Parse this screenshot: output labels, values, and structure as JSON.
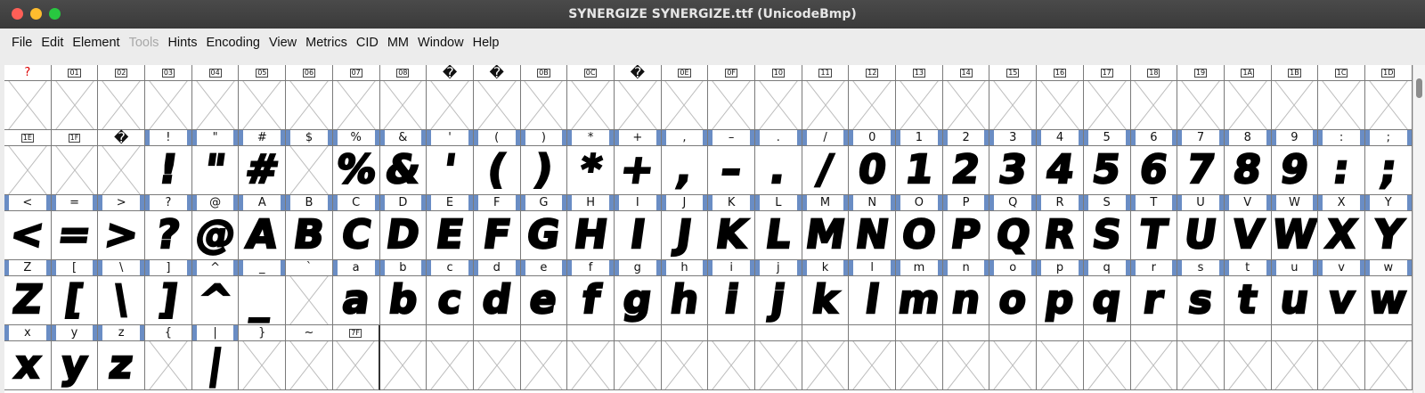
{
  "window": {
    "title": "SYNERGIZE  SYNERGIZE.ttf (UnicodeBmp)"
  },
  "menu": [
    {
      "label": "File",
      "enabled": true
    },
    {
      "label": "Edit",
      "enabled": true
    },
    {
      "label": "Element",
      "enabled": true
    },
    {
      "label": "Tools",
      "enabled": false
    },
    {
      "label": "Hints",
      "enabled": true
    },
    {
      "label": "Encoding",
      "enabled": true
    },
    {
      "label": "View",
      "enabled": true
    },
    {
      "label": "Metrics",
      "enabled": true
    },
    {
      "label": "CID",
      "enabled": true
    },
    {
      "label": "MM",
      "enabled": true
    },
    {
      "label": "Window",
      "enabled": true
    },
    {
      "label": "Help",
      "enabled": true
    }
  ],
  "grid": {
    "columns": 30,
    "rows": [
      [
        {
          "label": "?",
          "glyph": "",
          "style": "red"
        },
        {
          "label": "01",
          "glyph": "",
          "style": "box"
        },
        {
          "label": "02",
          "glyph": "",
          "style": "box"
        },
        {
          "label": "03",
          "glyph": "",
          "style": "box"
        },
        {
          "label": "04",
          "glyph": "",
          "style": "box"
        },
        {
          "label": "05",
          "glyph": "",
          "style": "box"
        },
        {
          "label": "06",
          "glyph": "",
          "style": "box"
        },
        {
          "label": "07",
          "glyph": "",
          "style": "box"
        },
        {
          "label": "08",
          "glyph": "",
          "style": "box"
        },
        {
          "label": "�",
          "glyph": "",
          "style": "q"
        },
        {
          "label": "�",
          "glyph": "",
          "style": "q"
        },
        {
          "label": "0B",
          "glyph": "",
          "style": "box"
        },
        {
          "label": "0C",
          "glyph": "",
          "style": "box"
        },
        {
          "label": "�",
          "glyph": "",
          "style": "q"
        },
        {
          "label": "0E",
          "glyph": "",
          "style": "box"
        },
        {
          "label": "0F",
          "glyph": "",
          "style": "box"
        },
        {
          "label": "10",
          "glyph": "",
          "style": "box"
        },
        {
          "label": "11",
          "glyph": "",
          "style": "box"
        },
        {
          "label": "12",
          "glyph": "",
          "style": "box"
        },
        {
          "label": "13",
          "glyph": "",
          "style": "box"
        },
        {
          "label": "14",
          "glyph": "",
          "style": "box"
        },
        {
          "label": "15",
          "glyph": "",
          "style": "box"
        },
        {
          "label": "16",
          "glyph": "",
          "style": "box"
        },
        {
          "label": "17",
          "glyph": "",
          "style": "box"
        },
        {
          "label": "18",
          "glyph": "",
          "style": "box"
        },
        {
          "label": "19",
          "glyph": "",
          "style": "box"
        },
        {
          "label": "1A",
          "glyph": "",
          "style": "box"
        },
        {
          "label": "1B",
          "glyph": "",
          "style": "box"
        },
        {
          "label": "1C",
          "glyph": "",
          "style": "box"
        },
        {
          "label": "1D",
          "glyph": "",
          "style": "box"
        }
      ],
      [
        {
          "label": "1E",
          "glyph": "",
          "style": "box"
        },
        {
          "label": "1F",
          "glyph": "",
          "style": "box"
        },
        {
          "label": "�",
          "glyph": "",
          "style": "q"
        },
        {
          "label": "!",
          "glyph": "!",
          "style": "hi"
        },
        {
          "label": "\"",
          "glyph": "\"",
          "style": "hi"
        },
        {
          "label": "#",
          "glyph": "#",
          "style": "hi"
        },
        {
          "label": "$",
          "glyph": "",
          "style": "hi"
        },
        {
          "label": "%",
          "glyph": "%",
          "style": "hi"
        },
        {
          "label": "&",
          "glyph": "&",
          "style": "hi"
        },
        {
          "label": "'",
          "glyph": "'",
          "style": "hi"
        },
        {
          "label": "(",
          "glyph": "(",
          "style": "hi"
        },
        {
          "label": ")",
          "glyph": ")",
          "style": "hi"
        },
        {
          "label": "*",
          "glyph": "*",
          "style": "hi"
        },
        {
          "label": "+",
          "glyph": "+",
          "style": "hi"
        },
        {
          "label": ",",
          "glyph": ",",
          "style": "hi"
        },
        {
          "label": "–",
          "glyph": "–",
          "style": "hi"
        },
        {
          "label": ".",
          "glyph": ".",
          "style": "hi"
        },
        {
          "label": "/",
          "glyph": "/",
          "style": "hi"
        },
        {
          "label": "0",
          "glyph": "0",
          "style": "hi"
        },
        {
          "label": "1",
          "glyph": "1",
          "style": "hi"
        },
        {
          "label": "2",
          "glyph": "2",
          "style": "hi"
        },
        {
          "label": "3",
          "glyph": "3",
          "style": "hi"
        },
        {
          "label": "4",
          "glyph": "4",
          "style": "hi"
        },
        {
          "label": "5",
          "glyph": "5",
          "style": "hi"
        },
        {
          "label": "6",
          "glyph": "6",
          "style": "hi"
        },
        {
          "label": "7",
          "glyph": "7",
          "style": "hi"
        },
        {
          "label": "8",
          "glyph": "8",
          "style": "hi"
        },
        {
          "label": "9",
          "glyph": "9",
          "style": "hi"
        },
        {
          "label": ":",
          "glyph": ":",
          "style": "hi"
        },
        {
          "label": ";",
          "glyph": ";",
          "style": "hi"
        }
      ],
      [
        {
          "label": "<",
          "glyph": "<",
          "style": "hi"
        },
        {
          "label": "=",
          "glyph": "=",
          "style": "hi"
        },
        {
          "label": ">",
          "glyph": ">",
          "style": "hi"
        },
        {
          "label": "?",
          "glyph": "?",
          "style": "hi"
        },
        {
          "label": "@",
          "glyph": "@",
          "style": "hi"
        },
        {
          "label": "A",
          "glyph": "A",
          "style": "hi"
        },
        {
          "label": "B",
          "glyph": "B",
          "style": "hi"
        },
        {
          "label": "C",
          "glyph": "C",
          "style": "hi"
        },
        {
          "label": "D",
          "glyph": "D",
          "style": "hi"
        },
        {
          "label": "E",
          "glyph": "E",
          "style": "hi"
        },
        {
          "label": "F",
          "glyph": "F",
          "style": "hi"
        },
        {
          "label": "G",
          "glyph": "G",
          "style": "hi"
        },
        {
          "label": "H",
          "glyph": "H",
          "style": "hi"
        },
        {
          "label": "I",
          "glyph": "I",
          "style": "hi"
        },
        {
          "label": "J",
          "glyph": "J",
          "style": "hi"
        },
        {
          "label": "K",
          "glyph": "K",
          "style": "hi"
        },
        {
          "label": "L",
          "glyph": "L",
          "style": "hi"
        },
        {
          "label": "M",
          "glyph": "M",
          "style": "hi"
        },
        {
          "label": "N",
          "glyph": "N",
          "style": "hi"
        },
        {
          "label": "O",
          "glyph": "O",
          "style": "hi"
        },
        {
          "label": "P",
          "glyph": "P",
          "style": "hi"
        },
        {
          "label": "Q",
          "glyph": "Q",
          "style": "hi"
        },
        {
          "label": "R",
          "glyph": "R",
          "style": "hi"
        },
        {
          "label": "S",
          "glyph": "S",
          "style": "hi"
        },
        {
          "label": "T",
          "glyph": "T",
          "style": "hi"
        },
        {
          "label": "U",
          "glyph": "U",
          "style": "hi"
        },
        {
          "label": "V",
          "glyph": "V",
          "style": "hi"
        },
        {
          "label": "W",
          "glyph": "W",
          "style": "hi"
        },
        {
          "label": "X",
          "glyph": "X",
          "style": "hi"
        },
        {
          "label": "Y",
          "glyph": "Y",
          "style": "hi"
        }
      ],
      [
        {
          "label": "Z",
          "glyph": "Z",
          "style": "hi"
        },
        {
          "label": "[",
          "glyph": "[",
          "style": "hi"
        },
        {
          "label": "\\",
          "glyph": "\\",
          "style": "hi"
        },
        {
          "label": "]",
          "glyph": "]",
          "style": "hi"
        },
        {
          "label": "^",
          "glyph": "^",
          "style": "hi"
        },
        {
          "label": "_",
          "glyph": "_",
          "style": "hi"
        },
        {
          "label": "`",
          "glyph": "",
          "style": "plain"
        },
        {
          "label": "a",
          "glyph": "a",
          "style": "hi"
        },
        {
          "label": "b",
          "glyph": "b",
          "style": "hi"
        },
        {
          "label": "c",
          "glyph": "c",
          "style": "hi"
        },
        {
          "label": "d",
          "glyph": "d",
          "style": "hi"
        },
        {
          "label": "e",
          "glyph": "e",
          "style": "hi"
        },
        {
          "label": "f",
          "glyph": "f",
          "style": "hi"
        },
        {
          "label": "g",
          "glyph": "g",
          "style": "hi"
        },
        {
          "label": "h",
          "glyph": "h",
          "style": "hi"
        },
        {
          "label": "i",
          "glyph": "i",
          "style": "hi"
        },
        {
          "label": "j",
          "glyph": "j",
          "style": "hi"
        },
        {
          "label": "k",
          "glyph": "k",
          "style": "hi"
        },
        {
          "label": "l",
          "glyph": "l",
          "style": "hi"
        },
        {
          "label": "m",
          "glyph": "m",
          "style": "hi"
        },
        {
          "label": "n",
          "glyph": "n",
          "style": "hi"
        },
        {
          "label": "o",
          "glyph": "o",
          "style": "hi"
        },
        {
          "label": "p",
          "glyph": "p",
          "style": "hi"
        },
        {
          "label": "q",
          "glyph": "q",
          "style": "hi"
        },
        {
          "label": "r",
          "glyph": "r",
          "style": "hi"
        },
        {
          "label": "s",
          "glyph": "s",
          "style": "hi"
        },
        {
          "label": "t",
          "glyph": "t",
          "style": "hi"
        },
        {
          "label": "u",
          "glyph": "u",
          "style": "hi"
        },
        {
          "label": "v",
          "glyph": "v",
          "style": "hi"
        },
        {
          "label": "w",
          "glyph": "w",
          "style": "hi"
        }
      ],
      [
        {
          "label": "x",
          "glyph": "x",
          "style": "hi"
        },
        {
          "label": "y",
          "glyph": "y",
          "style": "hi"
        },
        {
          "label": "z",
          "glyph": "z",
          "style": "hi"
        },
        {
          "label": "{",
          "glyph": "",
          "style": "plain"
        },
        {
          "label": "|",
          "glyph": "|",
          "style": "hi"
        },
        {
          "label": "}",
          "glyph": "",
          "style": "plain"
        },
        {
          "label": "~",
          "glyph": "",
          "style": "plain"
        },
        {
          "label": "7F",
          "glyph": "",
          "style": "box"
        },
        {
          "label": "",
          "glyph": "",
          "style": "plain"
        },
        {
          "label": "",
          "glyph": "",
          "style": "plain"
        },
        {
          "label": "",
          "glyph": "",
          "style": "plain"
        },
        {
          "label": "",
          "glyph": "",
          "style": "plain"
        },
        {
          "label": "",
          "glyph": "",
          "style": "plain"
        },
        {
          "label": "",
          "glyph": "",
          "style": "plain"
        },
        {
          "label": "",
          "glyph": "",
          "style": "plain"
        },
        {
          "label": "",
          "glyph": "",
          "style": "plain"
        },
        {
          "label": "",
          "glyph": "",
          "style": "plain"
        },
        {
          "label": "",
          "glyph": "",
          "style": "plain"
        },
        {
          "label": "",
          "glyph": "",
          "style": "plain"
        },
        {
          "label": "",
          "glyph": "",
          "style": "plain"
        },
        {
          "label": "",
          "glyph": "",
          "style": "plain"
        },
        {
          "label": "",
          "glyph": "",
          "style": "plain"
        },
        {
          "label": "",
          "glyph": "",
          "style": "plain"
        },
        {
          "label": "",
          "glyph": "",
          "style": "plain"
        },
        {
          "label": "",
          "glyph": "",
          "style": "plain"
        },
        {
          "label": "",
          "glyph": "",
          "style": "plain"
        },
        {
          "label": "",
          "glyph": "",
          "style": "plain"
        },
        {
          "label": "",
          "glyph": "",
          "style": "plain"
        },
        {
          "label": "",
          "glyph": "",
          "style": "plain"
        },
        {
          "label": "",
          "glyph": "",
          "style": "plain"
        }
      ]
    ]
  },
  "colors": {
    "label_highlight": "#6a8dc4",
    "missing_label": "#dd0000",
    "titlebar": "#3e3e3e"
  }
}
